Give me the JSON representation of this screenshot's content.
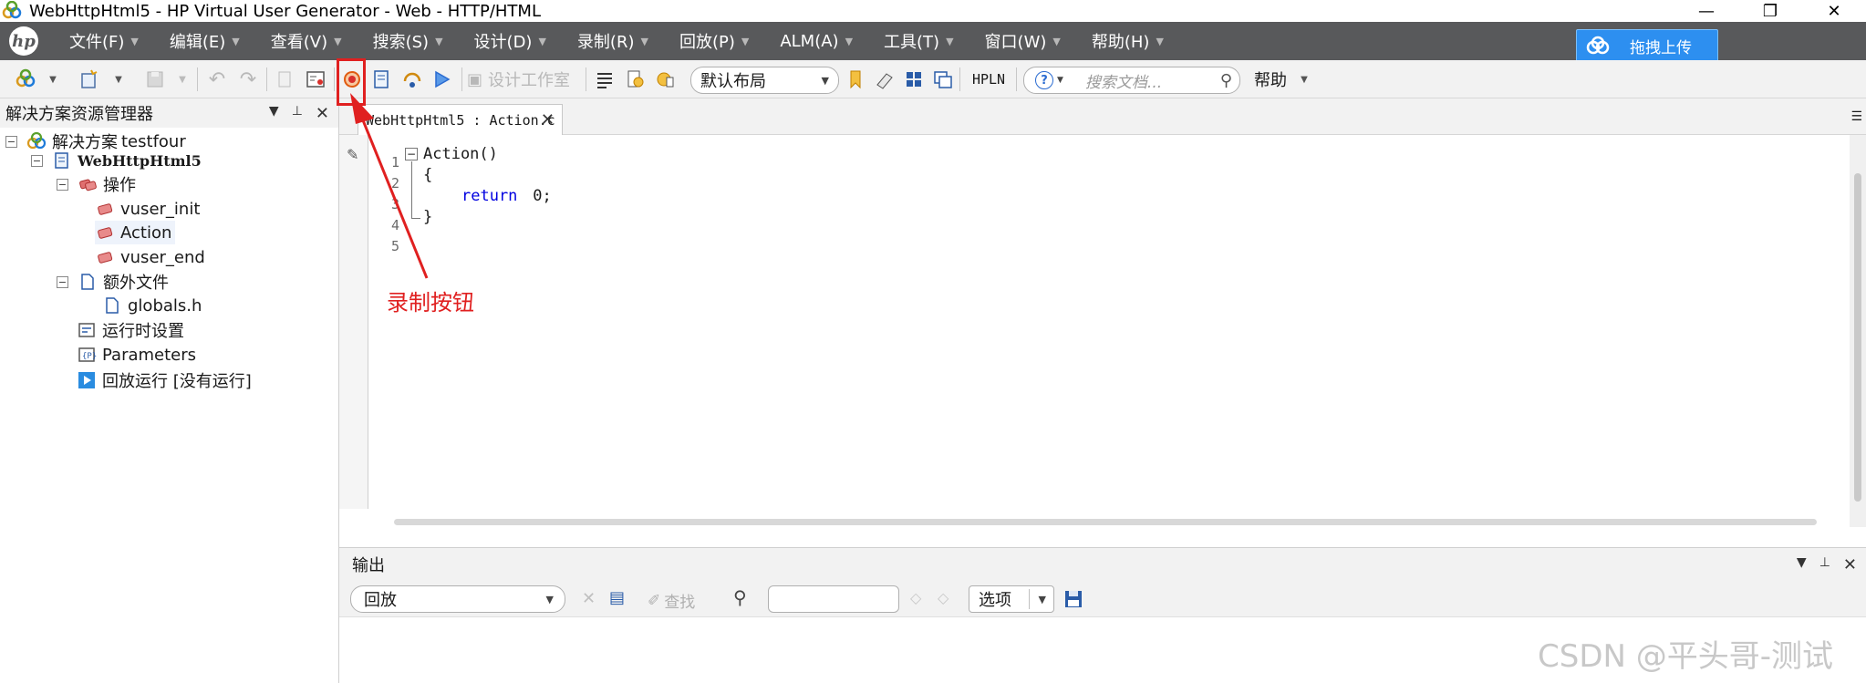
{
  "window": {
    "title": "WebHttpHtml5 - HP Virtual User Generator - Web - HTTP/HTML",
    "controls": [
      "—",
      "❐",
      "✕"
    ]
  },
  "menubar": {
    "logo_text": "hp",
    "items": [
      {
        "label": "文件(F)"
      },
      {
        "label": "编辑(E)"
      },
      {
        "label": "查看(V)"
      },
      {
        "label": "搜索(S)"
      },
      {
        "label": "设计(D)"
      },
      {
        "label": "录制(R)"
      },
      {
        "label": "回放(P)"
      },
      {
        "label": "ALM(A)"
      },
      {
        "label": "工具(T)"
      },
      {
        "label": "窗口(W)"
      },
      {
        "label": "帮助(H)"
      }
    ],
    "upload_button": "拖拽上传"
  },
  "toolbar": {
    "design_studio": "设计工作室",
    "layout_value": "默认布局",
    "hpln": "HPLN",
    "help_placeholder": "搜索文档...",
    "help_label": "帮助"
  },
  "solution_explorer": {
    "title": "解决方案资源管理器",
    "solution_prefix": "解决方案",
    "solution_name": "testfour",
    "script_name": "WebHttpHtml5",
    "actions_label": "操作",
    "actions": [
      "vuser_init",
      "Action",
      "vuser_end"
    ],
    "extra_files_label": "额外文件",
    "extra_files": [
      "globals.h"
    ],
    "runtime_settings": "运行时设置",
    "parameters": "Parameters",
    "replay_run": "回放运行 [没有运行]"
  },
  "editor": {
    "tab_label": "WebHttpHtml5 : Action.c",
    "line_numbers": [
      "1",
      "2",
      "3",
      "4",
      "5"
    ],
    "code": {
      "line1": "Action()",
      "line2": "{",
      "line3_kw": "return",
      "line3_rest": " 0;",
      "line4": "}"
    }
  },
  "annotation": {
    "text": "录制按钮",
    "color": "#e02020"
  },
  "output": {
    "title": "输出",
    "source_value": "回放",
    "find_label": "查找",
    "options_label": "选项"
  },
  "watermark": "CSDN @平头哥-测试",
  "colors": {
    "menubar_bg": "#58595b",
    "upload_bg": "#2d8ff0",
    "annotation_red": "#e02020"
  }
}
